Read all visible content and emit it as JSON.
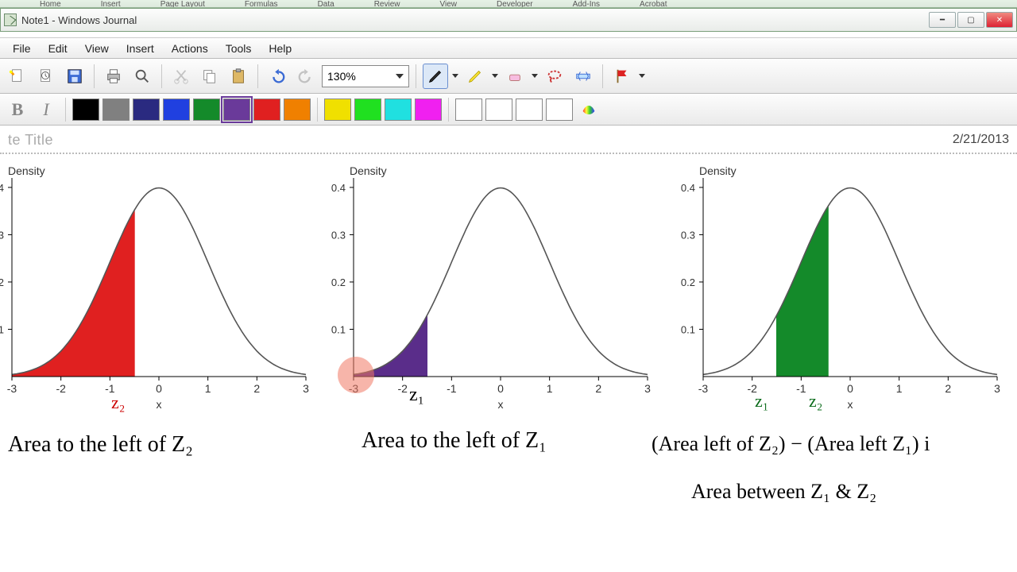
{
  "excel_tabs": [
    "Home",
    "Insert",
    "Page Layout",
    "Formulas",
    "Data",
    "Review",
    "View",
    "Developer",
    "Add-Ins",
    "Acrobat"
  ],
  "window": {
    "title": "Note1 - Windows Journal"
  },
  "menu": [
    "File",
    "Edit",
    "View",
    "Insert",
    "Actions",
    "Tools",
    "Help"
  ],
  "toolbar": {
    "zoom": "130%"
  },
  "colors": {
    "row": [
      "#000000",
      "#808080",
      "#2a2a80",
      "#2040e0",
      "#148a2a",
      "#6a3a9a",
      "#e02020",
      "#f08000"
    ],
    "row2": [
      "#f0e000",
      "#20e020",
      "#20e0e0",
      "#f020f0"
    ],
    "empties": 4,
    "selected_index": 5
  },
  "note": {
    "title_placeholder": "Note Title",
    "title_visible": "te Title",
    "date": "2/21/2013"
  },
  "charts": {
    "ylabel": "Density",
    "xlabel": "x",
    "xticks": [
      -3,
      -2,
      -1,
      0,
      1,
      2,
      3
    ],
    "yticks": [
      0.1,
      0.2,
      0.3,
      0.4
    ]
  },
  "annotations": {
    "z2_left": "z₂",
    "z1_mid": "z₁",
    "z1_right": "z₁",
    "z2_right": "z₂",
    "cap_left": "Area to the left of Z₂",
    "cap_mid": "Area to the left of Z₁",
    "cap_right1": "(Area left of Z₂) − (Area left Z₁)  i",
    "cap_right2": "Area between Z₁ & Z₂"
  },
  "chart_data": [
    {
      "type": "area",
      "title": "Density",
      "xlabel": "x",
      "ylabel": "Density",
      "xlim": [
        -3,
        3
      ],
      "ylim": [
        0,
        0.4
      ],
      "curve": "standard_normal_pdf",
      "shade": {
        "from": -3,
        "to": -0.5,
        "color": "#e02020",
        "label": "z2"
      }
    },
    {
      "type": "area",
      "title": "Density",
      "xlabel": "x",
      "ylabel": "Density",
      "xlim": [
        -3,
        3
      ],
      "ylim": [
        0,
        0.4
      ],
      "curve": "standard_normal_pdf",
      "shade": {
        "from": -3,
        "to": -1.5,
        "color": "#6a3a9a",
        "label": "z1"
      }
    },
    {
      "type": "area",
      "title": "Density",
      "xlabel": "x",
      "ylabel": "Density",
      "xlim": [
        -3,
        3
      ],
      "ylim": [
        0,
        0.4
      ],
      "curve": "standard_normal_pdf",
      "shade": {
        "from": -1.5,
        "to": -0.5,
        "color": "#148a2a",
        "labels": [
          "z1",
          "z2"
        ]
      }
    }
  ]
}
